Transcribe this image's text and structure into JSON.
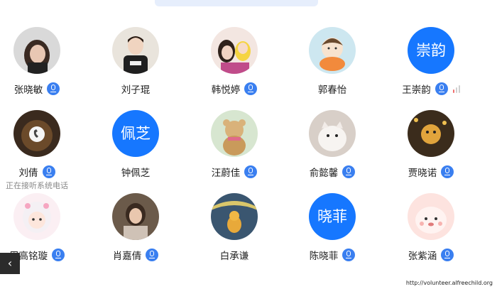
{
  "participants": [
    {
      "name": "张晓敏",
      "avatar_type": "photo",
      "mic": true
    },
    {
      "name": "刘子琨",
      "avatar_type": "photo",
      "mic": false
    },
    {
      "name": "韩悦婷",
      "avatar_type": "photo",
      "mic": true
    },
    {
      "name": "郭春怡",
      "avatar_type": "photo",
      "mic": false
    },
    {
      "name": "王崇韵",
      "avatar_type": "text",
      "avatar_text": "崇韵",
      "mic": true,
      "signal": true
    },
    {
      "name": "刘倩",
      "avatar_type": "photo",
      "mic": true,
      "status": "正在接听系统电话"
    },
    {
      "name": "钟佩芝",
      "avatar_type": "text",
      "avatar_text": "佩芝",
      "mic": false
    },
    {
      "name": "汪蔚佳",
      "avatar_type": "photo",
      "mic": true
    },
    {
      "name": "俞懿馨",
      "avatar_type": "photo",
      "mic": true
    },
    {
      "name": "贾晓诺",
      "avatar_type": "photo",
      "mic": true
    },
    {
      "name": "周高铭璇",
      "avatar_type": "photo",
      "mic": true
    },
    {
      "name": "肖嘉倩",
      "avatar_type": "photo",
      "mic": true
    },
    {
      "name": "白承谦",
      "avatar_type": "photo",
      "mic": false
    },
    {
      "name": "陈晓菲",
      "avatar_type": "text",
      "avatar_text": "晓菲",
      "mic": true
    },
    {
      "name": "张紫涵",
      "avatar_type": "photo",
      "mic": true
    }
  ],
  "controls": {
    "back_icon": "‹"
  },
  "watermark": "http://volunteer.alfreechild.org",
  "colors": {
    "accent": "#1677ff",
    "mic": "#3a7ff0"
  }
}
